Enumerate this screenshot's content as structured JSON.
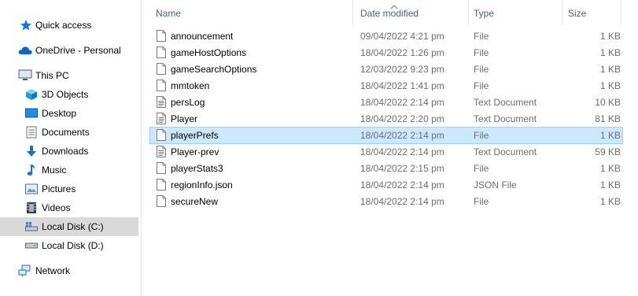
{
  "sidebar": {
    "items": [
      {
        "label": "Quick access",
        "icon": "star-icon"
      },
      {
        "label": "OneDrive - Personal",
        "icon": "cloud-icon"
      },
      {
        "label": "This PC",
        "icon": "computer-icon"
      },
      {
        "label": "3D Objects",
        "icon": "cube-icon"
      },
      {
        "label": "Desktop",
        "icon": "desktop-icon"
      },
      {
        "label": "Documents",
        "icon": "documents-icon"
      },
      {
        "label": "Downloads",
        "icon": "download-arrow-icon"
      },
      {
        "label": "Music",
        "icon": "music-note-icon"
      },
      {
        "label": "Pictures",
        "icon": "pictures-icon"
      },
      {
        "label": "Videos",
        "icon": "film-icon"
      },
      {
        "label": "Local Disk (C:)",
        "icon": "drive-c-icon"
      },
      {
        "label": "Local Disk (D:)",
        "icon": "drive-d-icon"
      },
      {
        "label": "Network",
        "icon": "network-icon"
      }
    ],
    "selected_index": 10
  },
  "columns": {
    "name": "Name",
    "date": "Date modified",
    "type": "Type",
    "size": "Size"
  },
  "files": [
    {
      "name": "announcement",
      "date": "09/04/2022 4:21 pm",
      "type": "File",
      "size": "1 KB"
    },
    {
      "name": "gameHostOptions",
      "date": "18/04/2022 1:26 pm",
      "type": "File",
      "size": "1 KB"
    },
    {
      "name": "gameSearchOptions",
      "date": "12/03/2022 9:23 pm",
      "type": "File",
      "size": "1 KB"
    },
    {
      "name": "mmtoken",
      "date": "18/04/2022 1:41 pm",
      "type": "File",
      "size": "1 KB"
    },
    {
      "name": "persLog",
      "date": "18/04/2022 2:14 pm",
      "type": "Text Document",
      "size": "10 KB"
    },
    {
      "name": "Player",
      "date": "18/04/2022 2:20 pm",
      "type": "Text Document",
      "size": "81 KB"
    },
    {
      "name": "playerPrefs",
      "date": "18/04/2022 2:14 pm",
      "type": "File",
      "size": "1 KB"
    },
    {
      "name": "Player-prev",
      "date": "18/04/2022 2:14 pm",
      "type": "Text Document",
      "size": "59 KB"
    },
    {
      "name": "playerStats3",
      "date": "18/04/2022 2:15 pm",
      "type": "File",
      "size": "1 KB"
    },
    {
      "name": "regionInfo.json",
      "date": "18/04/2022 2:14 pm",
      "type": "JSON File",
      "size": "1 KB"
    },
    {
      "name": "secureNew",
      "date": "18/04/2022 2:14 pm",
      "type": "File",
      "size": "1 KB"
    }
  ],
  "selected_file_index": 6,
  "colors": {
    "selection_bg": "#cce8ff",
    "selection_border": "#99d1ff",
    "sidebar_selected_bg": "#d9d9d9",
    "header_text": "#4c607a",
    "detail_text": "#6d6d6d"
  }
}
